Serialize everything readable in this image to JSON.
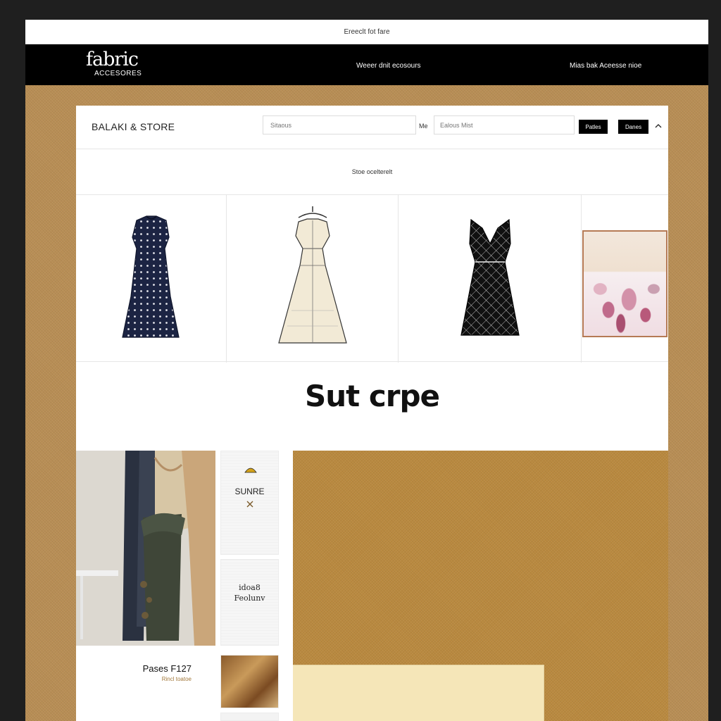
{
  "announcement": {
    "text": "Ereeclt fot fare"
  },
  "topnav": {
    "logo_main": "fabric",
    "logo_sub": "ACCESORES",
    "link_1": "Weeer dnit ecosours",
    "link_2": "Mias bak Aceesse nioe"
  },
  "store": {
    "name": "BALAKI & STORE",
    "search_placeholder": "Sitaous",
    "mid_label": "Me",
    "search2_placeholder": "Ealous Mist",
    "button_1": "Patles",
    "button_2": "Danes",
    "featured_label": "Stoe ocelterelt"
  },
  "products": [
    {
      "name": "polka-dot-dress"
    },
    {
      "name": "cream-sketch-dress"
    },
    {
      "name": "black-lattice-dress"
    },
    {
      "name": "floral-fabric-swatch"
    }
  ],
  "headline": "Sut crpe",
  "tiles": {
    "tile_1": "SUNRE",
    "tile_2_line1": "idoa8",
    "tile_2_line2": "Feolunv"
  },
  "price_card": {
    "title": "Pases F127",
    "subtitle": "Rincl toatoe"
  },
  "colors": {
    "accent_tan": "#b88e55",
    "fabric_gold": "#b9893f",
    "cream": "#f5e6b8",
    "ink": "#000000"
  },
  "icons": {
    "header_toggle": "chevron-up-icon",
    "tile_decor": "sun-icon"
  }
}
